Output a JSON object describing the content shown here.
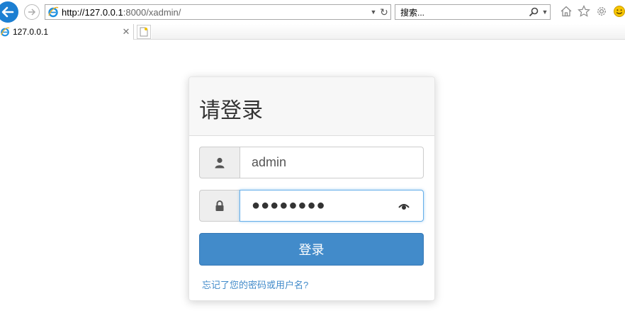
{
  "browser": {
    "address": {
      "host": "http://127.0.0.1",
      "rest": ":8000/xadmin/"
    },
    "search": {
      "placeholder": "搜索..."
    },
    "tab": {
      "title": "127.0.0.1"
    },
    "icons": [
      "back-icon",
      "forward-icon",
      "ie-logo-icon",
      "dropdown-icon",
      "refresh-icon",
      "search-icon",
      "home-icon",
      "favorites-star-icon",
      "settings-gear-icon",
      "smiley-feedback-icon",
      "close-icon",
      "new-tab-icon"
    ]
  },
  "login": {
    "title": "请登录",
    "username": {
      "value": "admin"
    },
    "password": {
      "masked": "●●●●●●●●"
    },
    "submit_label": "登录",
    "forgot_link": "忘记了您的密码或用户名?"
  },
  "colors": {
    "primary": "#428bca",
    "link": "#428bca",
    "ie_blue": "#1c7fd2",
    "focus": "#66afe9"
  }
}
